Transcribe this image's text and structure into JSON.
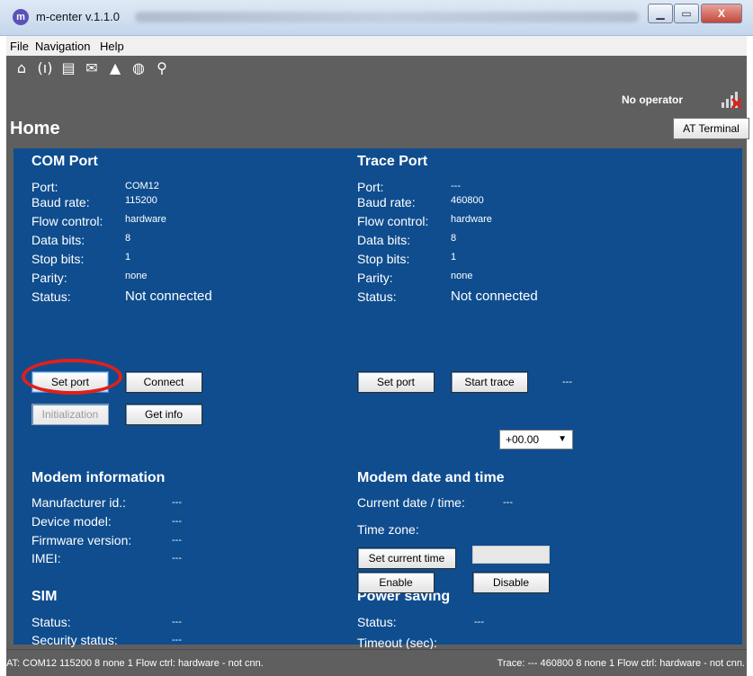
{
  "window": {
    "title": "m-center v.1.1.0",
    "app_icon_letter": "m",
    "controls": {
      "minimize": "▁",
      "maximize": "▭",
      "close": "X"
    }
  },
  "menu": [
    "File",
    "Navigation",
    "Help"
  ],
  "toolbar_icons": [
    "home-icon",
    "wireless-icon",
    "sms-icon",
    "mail-icon",
    "alert-icon",
    "globe-icon",
    "antenna-icon"
  ],
  "toolbar_glyphs": [
    "⌂",
    "(ı)",
    "▤",
    "✉",
    "▲",
    "◍",
    "⚲"
  ],
  "operator": "No operator",
  "page_title": "Home",
  "at_terminal_label": "AT Terminal",
  "com_port": {
    "title": "COM Port",
    "rows": [
      {
        "label": "Port:",
        "value": "COM12"
      },
      {
        "label": "Baud rate:",
        "value": "115200"
      },
      {
        "label": "Flow control:",
        "value": "hardware"
      },
      {
        "label": "Data bits:",
        "value": "8"
      },
      {
        "label": "Stop bits:",
        "value": "1"
      },
      {
        "label": "Parity:",
        "value": "none"
      },
      {
        "label": "Status:",
        "value": "Not connected"
      }
    ],
    "buttons": {
      "set_port": "Set port",
      "connect": "Connect",
      "initialization": "Initialization",
      "get_info": "Get info"
    }
  },
  "trace_port": {
    "title": "Trace Port",
    "rows": [
      {
        "label": "Port:",
        "value": "---"
      },
      {
        "label": "Baud rate:",
        "value": "460800"
      },
      {
        "label": "Flow control:",
        "value": "hardware"
      },
      {
        "label": "Data bits:",
        "value": "8"
      },
      {
        "label": "Stop bits:",
        "value": "1"
      },
      {
        "label": "Parity:",
        "value": "none"
      },
      {
        "label": "Status:",
        "value": "Not connected"
      }
    ],
    "buttons": {
      "set_port": "Set port",
      "start_trace": "Start trace"
    },
    "trace_value": "---"
  },
  "modem_info": {
    "title": "Modem information",
    "rows": [
      {
        "label": "Manufacturer id.:",
        "value": "---"
      },
      {
        "label": "Device model:",
        "value": "---"
      },
      {
        "label": "Firmware version:",
        "value": "---"
      },
      {
        "label": "IMEI:",
        "value": "---"
      }
    ]
  },
  "modem_datetime": {
    "title": "Modem date and time",
    "current_label": "Current date / time:",
    "current_value": "---",
    "tz_label": "Time zone:",
    "tz_value": "+00.00",
    "set_time_label": "Set current time"
  },
  "sim": {
    "title": "SIM",
    "rows": [
      {
        "label": "Status:",
        "value": "---"
      },
      {
        "label": "Security status:",
        "value": "---"
      }
    ]
  },
  "power_saving": {
    "title": "Power saving",
    "status_label": "Status:",
    "status_value": "---",
    "timeout_label": "Timeout (sec):",
    "timeout_value": "",
    "enable_label": "Enable",
    "disable_label": "Disable"
  },
  "statusbar": {
    "left": "AT: COM12 115200 8 none 1 Flow ctrl: hardware - not cnn.",
    "right": "Trace: --- 460800 8 none 1 Flow ctrl: hardware - not cnn."
  },
  "colors": {
    "panel": "#0f4d8f",
    "app_bg": "#5f5f5f",
    "highlight": "#e0201a"
  }
}
